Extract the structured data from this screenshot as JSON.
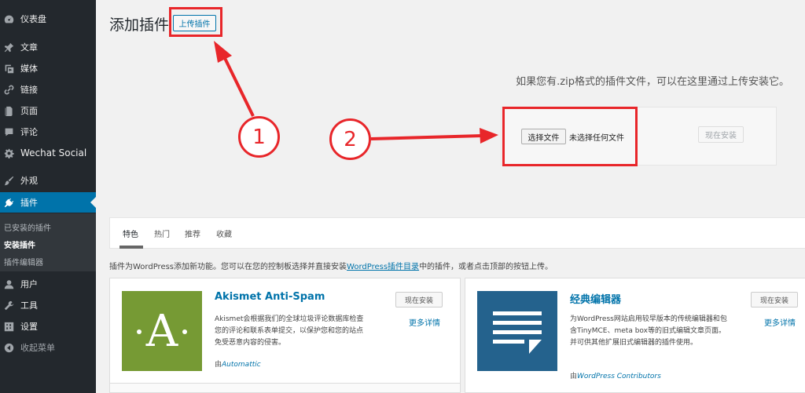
{
  "sidebar": {
    "items": [
      {
        "label": "仪表盘",
        "icon": "dashboard-icon"
      },
      {
        "label": "文章",
        "icon": "pin-icon"
      },
      {
        "label": "媒体",
        "icon": "media-icon"
      },
      {
        "label": "链接",
        "icon": "link-icon"
      },
      {
        "label": "页面",
        "icon": "page-icon"
      },
      {
        "label": "评论",
        "icon": "comment-icon"
      },
      {
        "label": "Wechat Social",
        "icon": "gear-icon"
      },
      {
        "label": "外观",
        "icon": "brush-icon"
      },
      {
        "label": "插件",
        "icon": "plugin-icon"
      },
      {
        "label": "用户",
        "icon": "user-icon"
      },
      {
        "label": "工具",
        "icon": "wrench-icon"
      },
      {
        "label": "设置",
        "icon": "settings-icon"
      },
      {
        "label": "收起菜单",
        "icon": "collapse-icon"
      }
    ],
    "submenu": [
      "已安装的插件",
      "安装插件",
      "插件编辑器"
    ]
  },
  "header": {
    "title": "添加插件",
    "upload_button": "上传插件"
  },
  "upload": {
    "help": "如果您有.zip格式的插件文件，可以在这里通过上传安装它。",
    "choose_file": "选择文件",
    "no_file": "未选择任何文件",
    "install_now": "现在安装"
  },
  "annotations": {
    "step1": "1",
    "step2": "2",
    "color": "#e8262a"
  },
  "tabs": [
    "特色",
    "热门",
    "推荐",
    "收藏"
  ],
  "intro": {
    "before": "插件为WordPress添加新功能。您可以在您的控制板选择并直接安装",
    "link": "WordPress插件目录",
    "after": "中的插件，或者点击顶部的按钮上传。"
  },
  "plugins": [
    {
      "name": "Akismet Anti-Spam",
      "desc": "Akismet会根据我们的全球垃圾评论数据库检查您的评论和联系表单提交，以保护您和您的站点免受恶意内容的侵害。",
      "by": "由",
      "author": "Automattic",
      "install": "现在安装",
      "more": "更多详情",
      "logo": "A"
    },
    {
      "name": "经典编辑器",
      "desc": "为WordPress网站启用较早版本的传统编辑器和包含TinyMCE、meta box等的旧式编辑文章页面。并可供其他扩展旧式编辑器的插件使用。",
      "by": "由",
      "author": "WordPress Contributors",
      "install": "现在安装",
      "more": "更多详情"
    }
  ]
}
